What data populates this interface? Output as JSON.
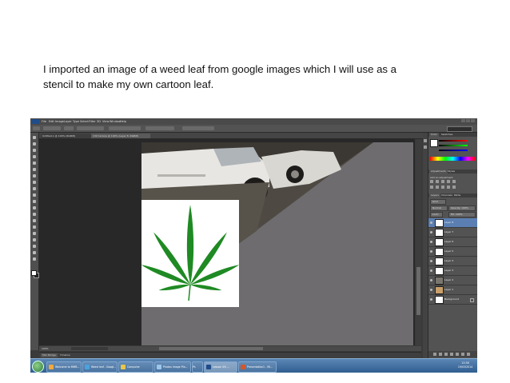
{
  "caption": {
    "line1": "I imported an image of a weed leaf from google images which I will use as a",
    "line2": "stencil to make my own cartoon leaf."
  },
  "app": {
    "menus": [
      "Ps",
      "File",
      "Edit",
      "Image",
      "Layer",
      "Type",
      "Select",
      "Filter",
      "3D",
      "View",
      "Window",
      "Help"
    ],
    "workspace": "Essentials",
    "zoom": "100%"
  },
  "document_tabs": [
    "Untitled-1 @ 100% (RGB/8)",
    "130 Carrera @ 100% (Layer 8, RGB/8)"
  ],
  "panels": {
    "color_tabs": [
      "Color",
      "Swatches"
    ],
    "adjust_tabs": [
      "Adjustments",
      "Styles"
    ],
    "adjust_label": "Add an adjustment",
    "layer_tabs": [
      "Layers",
      "Channels",
      "Paths"
    ],
    "kind": "Kind",
    "blend": "Normal",
    "opacity": "Opacity: 100%",
    "lock": "Lock:",
    "fill": "Fill: 100%",
    "layers": [
      "Layer 8",
      "Layer 7",
      "Layer 6",
      "Layer 5",
      "Layer 4",
      "Layer 3",
      "Layer 2",
      "Layer 1",
      "Background"
    ]
  },
  "mini_bridge": [
    "Mini Bridge",
    "Timeline"
  ],
  "taskbar": {
    "tasks": [
      "Welcome to MMB...",
      "Weed leaf - Googl...",
      "Computer",
      "Photos Image Pla...",
      "Ps",
      "Lesson 4% ...",
      "Presentation1 - Mi..."
    ],
    "time": "13:38",
    "date": "19/03/2014"
  },
  "colors": {
    "accent_layer_selected": "#5b7fb3",
    "leaf_green": "#1f8a23",
    "canvas_gray": "#6e6c6f",
    "taskbar_blue": "#2d5c8e"
  }
}
